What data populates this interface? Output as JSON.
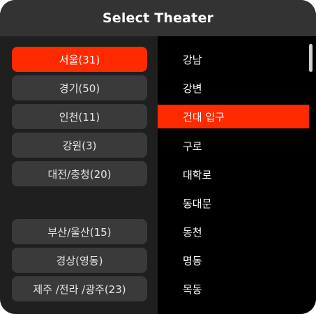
{
  "header": {
    "title": "Select Theater"
  },
  "regions": [
    {
      "label": "서울(31)",
      "selected": true
    },
    {
      "label": "경기(50)",
      "selected": false
    },
    {
      "label": "인천(11)",
      "selected": false
    },
    {
      "label": "강원(3)",
      "selected": false
    },
    {
      "label": "대전/충청(20)",
      "selected": false
    },
    {
      "label": "부산/울산(15)",
      "selected": false
    },
    {
      "label": "경상(영동)",
      "selected": false
    },
    {
      "label": "제주 /전라 /광주(23)",
      "selected": false
    }
  ],
  "theaters": [
    {
      "label": "강남",
      "selected": false
    },
    {
      "label": "강변",
      "selected": false
    },
    {
      "label": "건대 입구",
      "selected": true
    },
    {
      "label": "구로",
      "selected": false
    },
    {
      "label": "대학로",
      "selected": false
    },
    {
      "label": "동대문",
      "selected": false
    },
    {
      "label": "동천",
      "selected": false
    },
    {
      "label": "명동",
      "selected": false
    },
    {
      "label": "목동",
      "selected": false
    }
  ],
  "colors": {
    "accent": "#ff2a00",
    "header_bg": "#333333",
    "button_bg": "#3a3a3a",
    "list_bg": "#000000"
  }
}
